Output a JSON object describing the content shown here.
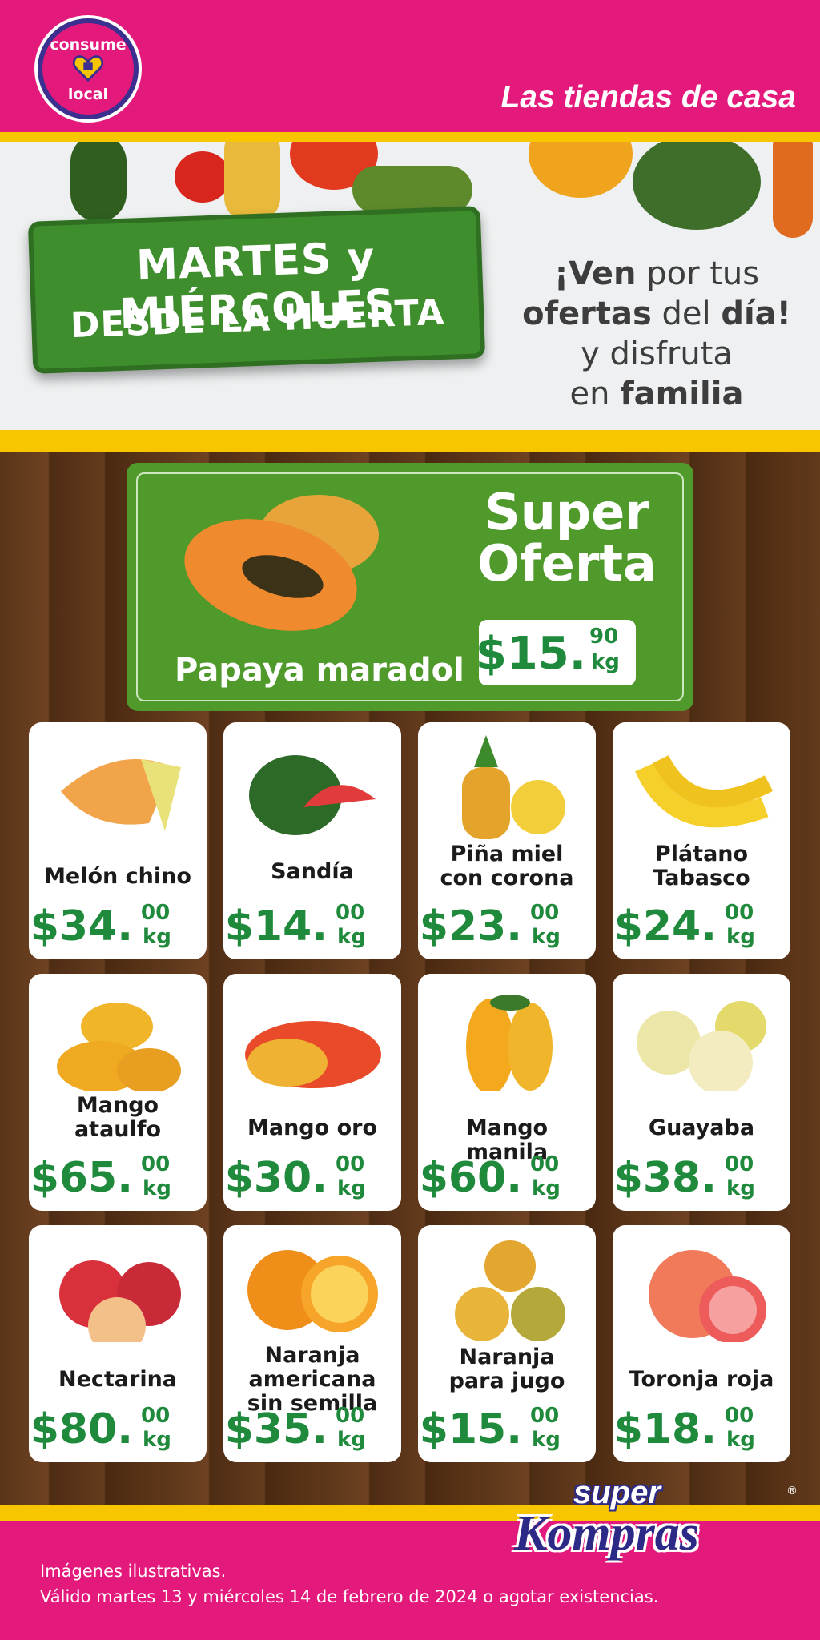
{
  "header": {
    "badge_top": "consume",
    "badge_bottom": "local",
    "tagline": "Las tiendas de casa"
  },
  "hero": {
    "sign_line1": "MARTES y MIÉRCOLES",
    "sign_line2": "DESDE LA HUERTA",
    "msg": {
      "l1a": "¡Ven",
      "l1b": " por tus",
      "l2a": "ofertas",
      "l2b": " del ",
      "l2c": "día!",
      "l3": "y disfruta",
      "l4a": "en ",
      "l4b": "familia"
    }
  },
  "offer": {
    "title_line1": "Super",
    "title_line2": "Oferta",
    "name": "Papaya maradol",
    "price_main": "$15.",
    "price_cents": "90",
    "price_unit": "kg"
  },
  "products": [
    {
      "name": "Melón chino",
      "price_main": "$34.",
      "cents": "00",
      "unit": "kg"
    },
    {
      "name": "Sandía",
      "price_main": "$14.",
      "cents": "00",
      "unit": "kg"
    },
    {
      "name": "Piña miel con corona",
      "price_main": "$23.",
      "cents": "00",
      "unit": "kg"
    },
    {
      "name": "Plátano Tabasco",
      "price_main": "$24.",
      "cents": "00",
      "unit": "kg"
    },
    {
      "name": "Mango ataulfo",
      "price_main": "$65.",
      "cents": "00",
      "unit": "kg"
    },
    {
      "name": "Mango oro",
      "price_main": "$30.",
      "cents": "00",
      "unit": "kg"
    },
    {
      "name": "Mango manila",
      "price_main": "$60.",
      "cents": "00",
      "unit": "kg"
    },
    {
      "name": "Guayaba",
      "price_main": "$38.",
      "cents": "00",
      "unit": "kg"
    },
    {
      "name": "Nectarina",
      "price_main": "$80.",
      "cents": "00",
      "unit": "kg"
    },
    {
      "name": "Naranja americana sin semilla",
      "price_main": "$35.",
      "cents": "00",
      "unit": "kg"
    },
    {
      "name": "Naranja para jugo",
      "price_main": "$15.",
      "cents": "00",
      "unit": "kg"
    },
    {
      "name": "Toronja roja",
      "price_main": "$18.",
      "cents": "00",
      "unit": "kg"
    }
  ],
  "footer": {
    "logo_super": "super",
    "logo_kompras": "Kompras",
    "logo_reg": "®",
    "disclaimer_line1": "Imágenes ilustrativas.",
    "disclaimer_line2": "Válido martes 13 y miércoles 14 de febrero de 2024 o agotar existencias."
  },
  "colors": {
    "brand_pink": "#e4197c",
    "brand_yellow": "#f7c600",
    "offer_green": "#4f9a2b",
    "price_green": "#1f8a3c",
    "logo_blue": "#2d2a87"
  }
}
